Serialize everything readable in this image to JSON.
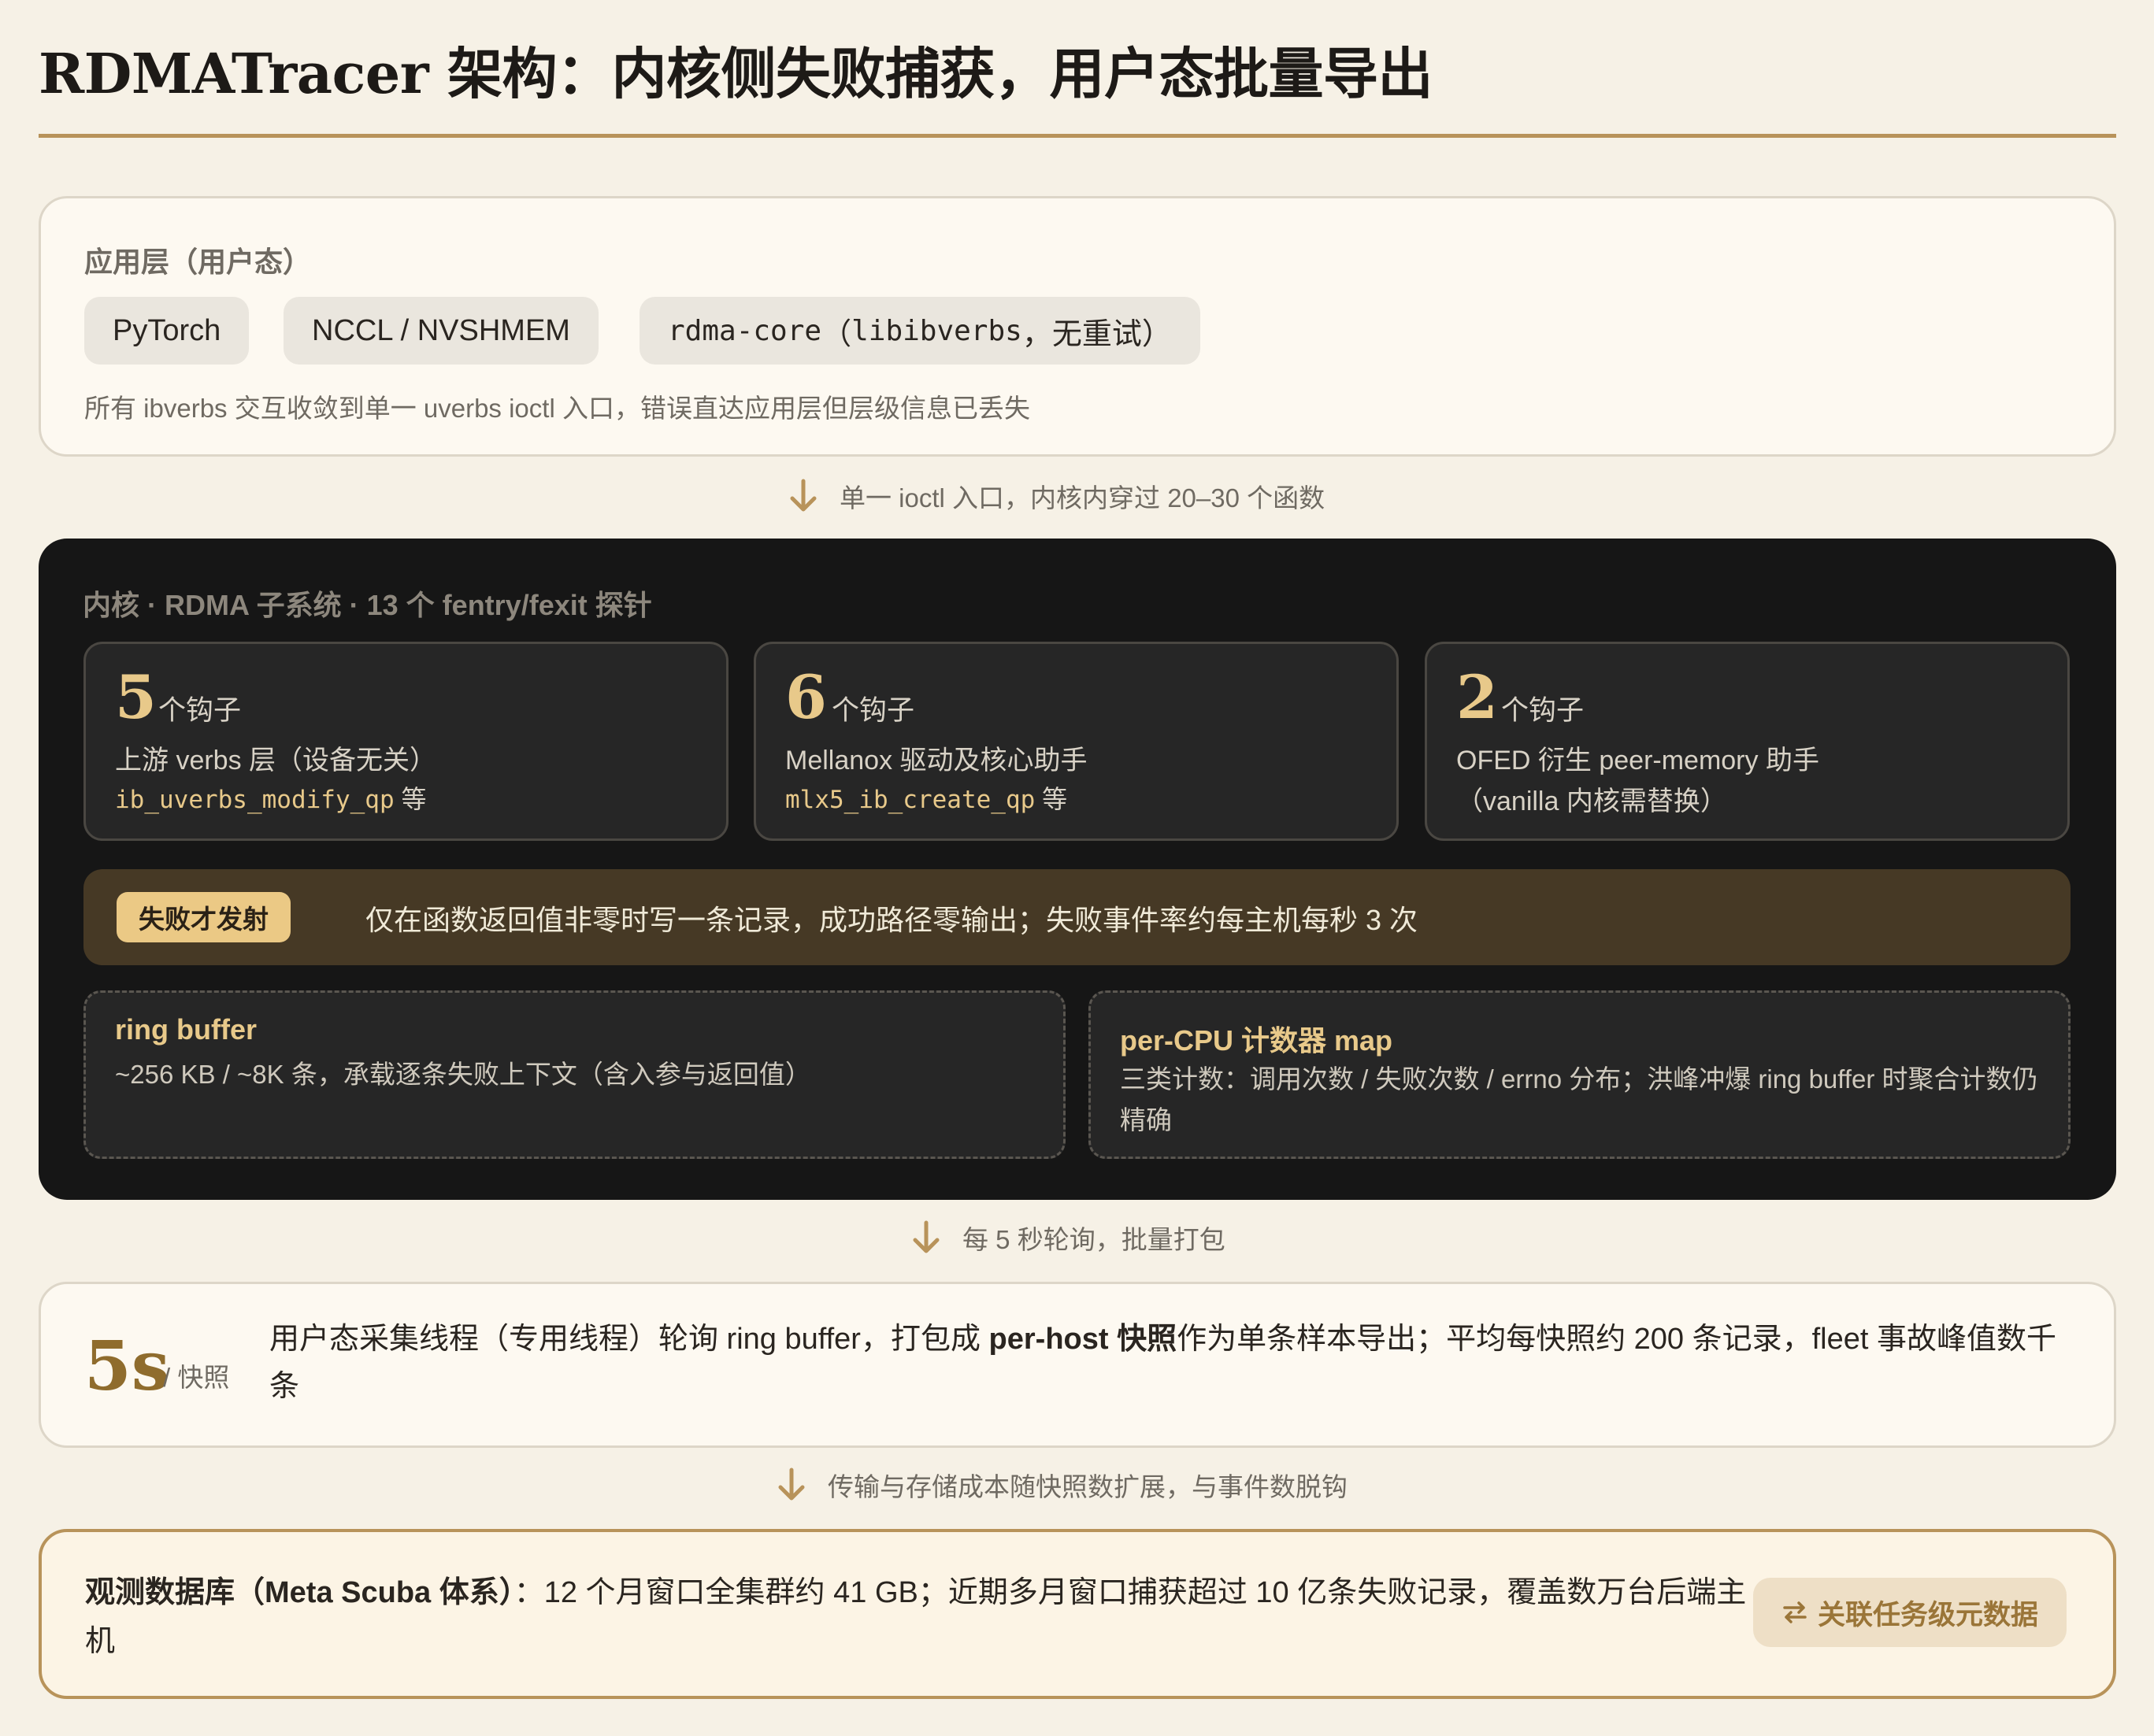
{
  "title": "RDMATracer 架构：内核侧失败捕获，用户态批量导出",
  "app_layer": {
    "label": "应用层（用户态）",
    "chips": [
      "PyTorch",
      "NCCL / NVSHMEM"
    ],
    "rdma_chip_mono": "rdma-core",
    "rdma_chip_open": "（",
    "rdma_chip_lib": "libibverbs",
    "rdma_chip_tail": "，无重试）",
    "note": "所有 ibverbs 交互收敛到单一 uverbs ioctl 入口，错误直达应用层但层级信息已丢失"
  },
  "connectors": [
    "单一 ioctl 入口，内核内穿过 20–30 个函数",
    "每 5 秒轮询，批量打包",
    "传输与存储成本随快照数扩展，与事件数脱钩"
  ],
  "kernel": {
    "label": "内核 · RDMA 子系统 · 13 个 fentry/fexit 探针",
    "hook_unit": "个钩子",
    "hooks": [
      {
        "count": "5",
        "desc": "上游 verbs 层（设备无关）",
        "fn": "ib_uverbs_modify_qp",
        "suffix": " 等"
      },
      {
        "count": "6",
        "desc": "Mellanox 驱动及核心助手",
        "fn": "mlx5_ib_create_qp",
        "suffix": " 等"
      },
      {
        "count": "2",
        "desc": "OFED 衍生 peer-memory 助手",
        "desc2": "（vanilla 内核需替换）"
      }
    ],
    "fail_badge": "失败才发射",
    "fail_text": "仅在函数返回值非零时写一条记录，成功路径零输出；失败事件率约每主机每秒 3 次",
    "ring_buffer": {
      "title": "ring buffer",
      "desc": "~256 KB / ~8K 条，承载逐条失败上下文（含入参与返回值）"
    },
    "percpu_map": {
      "title": "per-CPU 计数器 map",
      "desc": "三类计数：调用次数 / 失败次数 / errno 分布；洪峰冲爆 ring buffer 时聚合计数仍精确"
    }
  },
  "snapshot": {
    "num": "5s",
    "unit": "/ 快照",
    "text_pre": "用户态采集线程（专用线程）轮询 ring buffer，打包成 ",
    "text_bold": "per-host 快照",
    "text_post": "作为单条样本导出；平均每快照约 200 条记录，fleet 事故峰值数千条"
  },
  "database": {
    "bold": "观测数据库（Meta Scuba 体系）",
    "text": "：12 个月窗口全集群约 41 GB；近期多月窗口捕获超过 10 亿条失败记录，覆盖数万台后端主机",
    "button": "关联任务级元数据",
    "button_icon": "swap-arrows-icon"
  },
  "colors": {
    "background": "#f6f1e6",
    "accent": "#b8935a",
    "kernel_bg": "#161616",
    "hook_number": "#e8c98a",
    "fail_badge": "#ebc985"
  }
}
